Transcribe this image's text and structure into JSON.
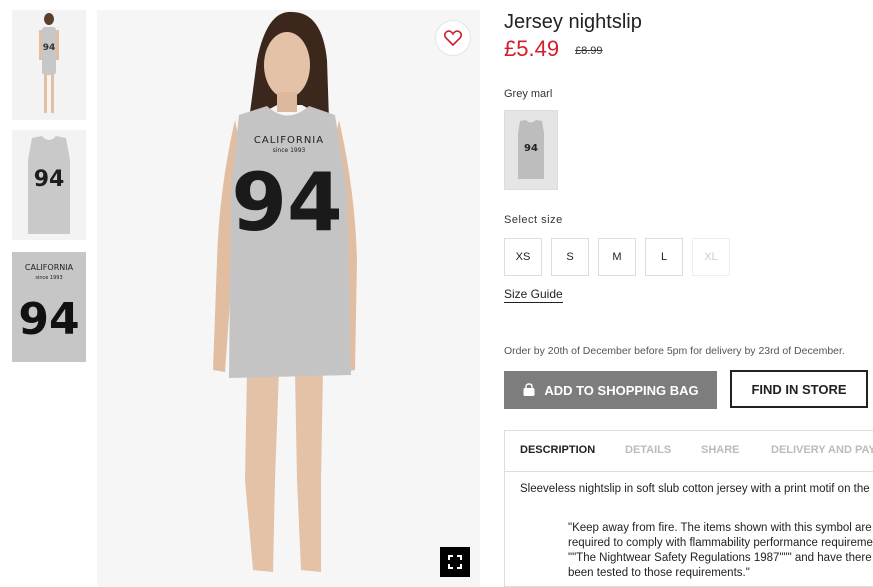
{
  "product": {
    "title": "Jersey nightslip",
    "price": "£5.49",
    "old_price": "£8.99",
    "color_label": "Grey marl",
    "print_text": "CALIFORNIA",
    "print_since": "since 1993",
    "print_number": "94"
  },
  "sizes": {
    "label": "Select size",
    "options": [
      "XS",
      "S",
      "M",
      "L",
      "XL"
    ],
    "guide": "Size Guide"
  },
  "delivery_note": "Order by 20th of December before 5pm for delivery by 23rd of December.",
  "actions": {
    "add_to_bag": "ADD TO SHOPPING BAG",
    "find_in_store": "FIND IN STORE"
  },
  "tabs": [
    "DESCRIPTION",
    "DETAILS",
    "SHARE",
    "DELIVERY AND PAYMENT"
  ],
  "description": "Sleeveless nightslip in soft slub cotton jersey with a print motif on the front.",
  "notice_lines": [
    "\"Keep away from fire. The items shown with this symbol are",
    "required to comply with flammability performance requirements",
    "\"\"The Nightwear Safety Regulations 1987\"\"\" and have there",
    "been tested to those requirements.\""
  ],
  "icons": {
    "favorite": "heart-icon",
    "zoom": "fullscreen-icon",
    "bag": "shopping-bag-icon"
  },
  "colors": {
    "price": "#d11f2b",
    "bag_button": "#7d7d7d"
  }
}
